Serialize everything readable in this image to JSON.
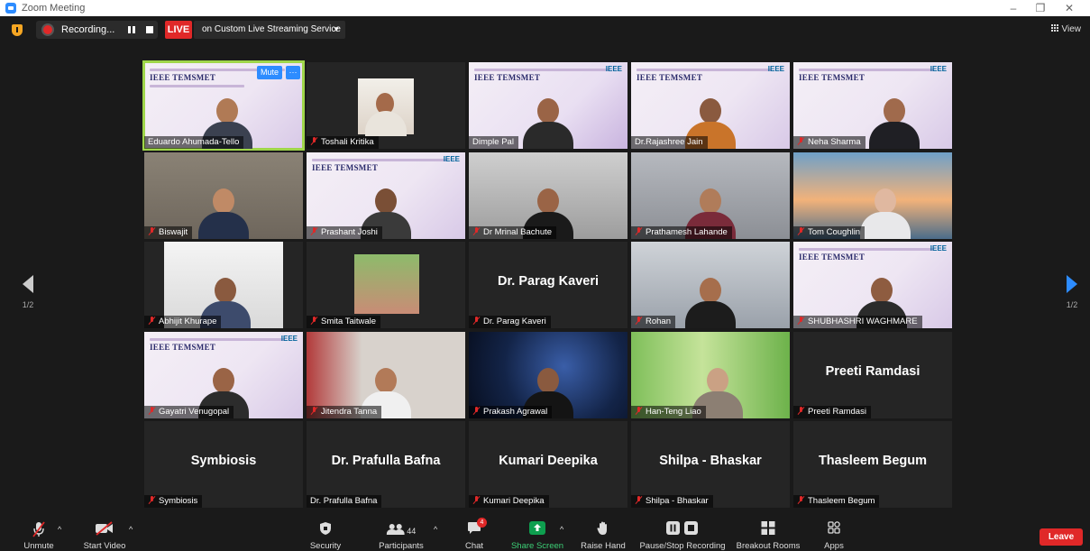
{
  "window": {
    "title": "Zoom Meeting",
    "minimize": "–",
    "restore": "❐",
    "close": "✕"
  },
  "topbar": {
    "recording": "Recording...",
    "live": "LIVE",
    "stream": "on Custom Live Streaming Service",
    "view": "View"
  },
  "paging": {
    "left": "1/2",
    "right": "1/2"
  },
  "banner": {
    "title": "IEEE TEMSMET",
    "org": "IEEE"
  },
  "tiles": [
    {
      "name": "Eduardo Ahumada-Tello",
      "muted": false
    },
    {
      "name": "Toshali Kritika",
      "muted": true
    },
    {
      "name": "Dimple Pal",
      "muted": false
    },
    {
      "name": "Dr.Rajashree Jain",
      "muted": false
    },
    {
      "name": "Neha Sharma",
      "muted": true
    },
    {
      "name": "Biswajit",
      "muted": true
    },
    {
      "name": "Prashant Joshi",
      "muted": true
    },
    {
      "name": "Dr Mrinal Bachute",
      "muted": true
    },
    {
      "name": "Prathamesh Lahande",
      "muted": true
    },
    {
      "name": "Tom Coughlin",
      "muted": true
    },
    {
      "name": "Abhijit Khurape",
      "muted": true
    },
    {
      "name": "Smita Taitwale",
      "muted": true
    },
    {
      "name": "Dr. Parag Kaveri",
      "muted": true,
      "big": "Dr. Parag Kaveri"
    },
    {
      "name": "Rohan",
      "muted": true
    },
    {
      "name": "SHUBHASHRI WAGHMARE",
      "muted": true
    },
    {
      "name": "Gayatri Venugopal",
      "muted": true
    },
    {
      "name": "Jitendra Tanna",
      "muted": true
    },
    {
      "name": "Prakash Agrawal",
      "muted": true
    },
    {
      "name": "Han-Teng Liao",
      "muted": true
    },
    {
      "name": "Preeti Ramdasi",
      "muted": true,
      "big": "Preeti Ramdasi"
    },
    {
      "name": "Symbiosis",
      "muted": true,
      "big": "Symbiosis"
    },
    {
      "name": "Dr. Prafulla Bafna",
      "muted": false,
      "big": "Dr. Prafulla Bafna"
    },
    {
      "name": "Kumari Deepika",
      "muted": true,
      "big": "Kumari Deepika"
    },
    {
      "name": "Shilpa - Bhaskar",
      "muted": true,
      "big": "Shilpa - Bhaskar"
    },
    {
      "name": "Thasleem Begum",
      "muted": true,
      "big": "Thasleem Begum"
    }
  ],
  "tile_controls": {
    "mute": "Mute",
    "more": "···"
  },
  "toolbar": {
    "unmute": "Unmute",
    "start_video": "Start Video",
    "security": "Security",
    "participants": "Participants",
    "participants_count": "44",
    "chat": "Chat",
    "chat_badge": "4",
    "share_screen": "Share Screen",
    "raise_hand": "Raise Hand",
    "pause_stop": "Pause/Stop Recording",
    "breakout": "Breakout Rooms",
    "apps": "Apps",
    "leave": "Leave"
  },
  "colors": {
    "accent": "#2d8cff",
    "live": "#e02828",
    "share": "#0e9f4f",
    "active_speaker": "#9fd64a"
  }
}
